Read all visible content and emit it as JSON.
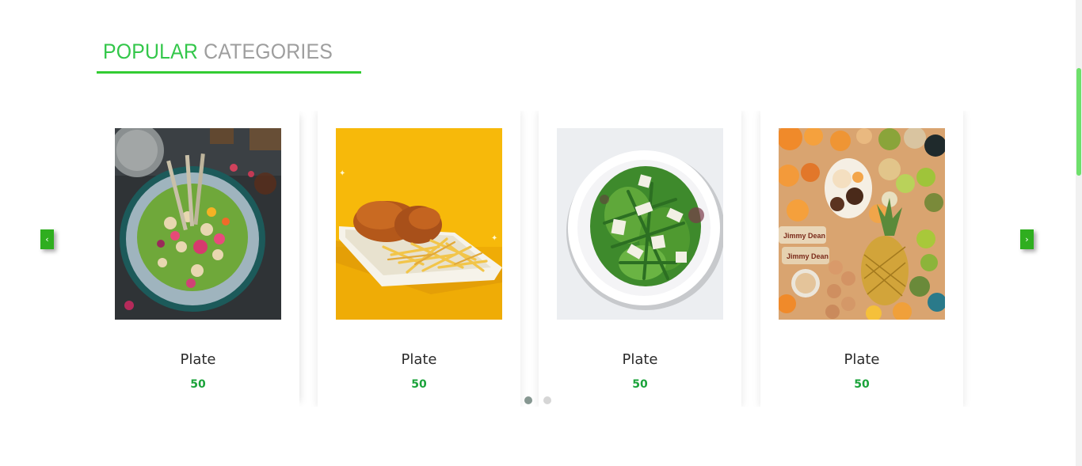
{
  "section": {
    "title_accent": "POPULAR",
    "title_rest": "CATEGORIES"
  },
  "carousel": {
    "prev_label": "‹",
    "next_label": "›",
    "items": [
      {
        "name": "Plate",
        "price": "50",
        "image": "salad-bowl-photo"
      },
      {
        "name": "Plate",
        "price": "50",
        "image": "fried-chicken-fries-photo"
      },
      {
        "name": "Plate",
        "price": "50",
        "image": "green-salad-plate-photo"
      },
      {
        "name": "Plate",
        "price": "50",
        "image": "fruits-assortment-photo"
      }
    ],
    "pages": 2,
    "active_page": 1
  },
  "colors": {
    "accent": "#33c74a",
    "price": "#1aa33a",
    "nav": "#2fae1f"
  }
}
